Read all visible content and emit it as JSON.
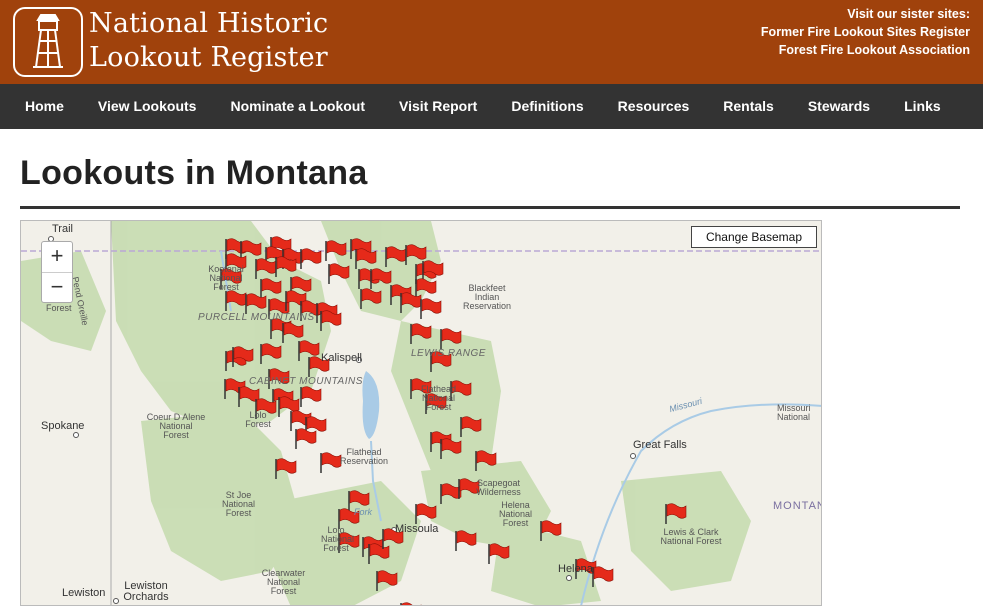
{
  "header": {
    "title_line1": "National Historic",
    "title_line2": "Lookout Register",
    "sister_heading": "Visit our sister sites:",
    "sister_links": [
      "Former Fire Lookout Sites Register",
      "Forest Fire Lookout Association"
    ]
  },
  "nav": {
    "items": [
      "Home",
      "View Lookouts",
      "Nominate a Lookout",
      "Visit Report",
      "Definitions",
      "Resources",
      "Rentals",
      "Stewards",
      "Links"
    ]
  },
  "page": {
    "title": "Lookouts in Montana"
  },
  "map": {
    "change_basemap": "Change Basemap",
    "zoom_in": "+",
    "zoom_out": "−",
    "cities": [
      "Trail",
      "Spokane",
      "Kalispell",
      "Missoula",
      "Great Falls",
      "Helena",
      "Lewiston",
      "Lewiston Orchards"
    ],
    "labels": {
      "kootenai": "Kootenai National Forest",
      "colville": "Forest",
      "pend_oreille": "Pend Oreille",
      "blackfeet": "Blackfeet Indian Reservation",
      "purcell": "PURCELL MOUNTAINS",
      "lewis_range": "LEWIS RANGE",
      "cabinet": "CABINET MOUNTAINS",
      "flathead_nf": "Flathead National Forest",
      "coeur": "Coeur D Alene National Forest",
      "lolo": "Lolo Forest",
      "flathead_res": "Flathead Reservation",
      "scapegoat": "Scapegoat Wilderness",
      "helena_nf": "Helena National Forest",
      "st_joe": "St Joe National Forest",
      "lolo2": "Lolo National Forest",
      "clearwater": "Clearwater National Forest",
      "lewis_clark": "Lewis & Clark National Forest",
      "missouri_river": "Missouri",
      "missouri_nf": "Missouri National",
      "montana": "MONTAN",
      "flathead_river": "Fork"
    },
    "flag_color": "#e52a1a",
    "flag_icon": "red-flag-icon",
    "flag_count": 81
  }
}
